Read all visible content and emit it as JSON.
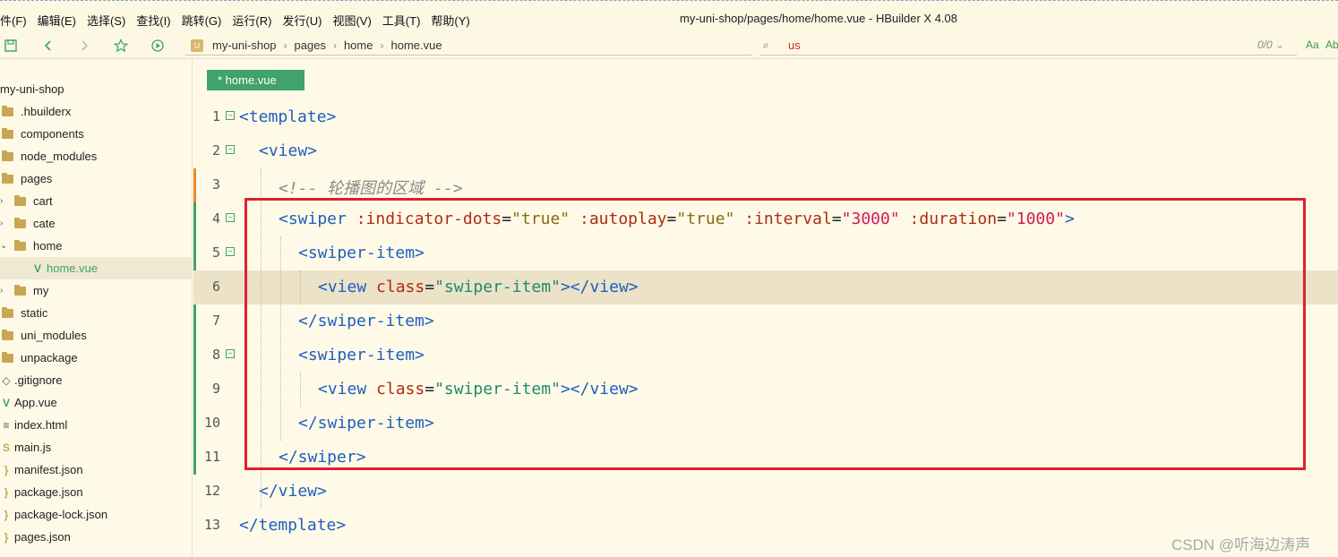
{
  "menubar": {
    "items": [
      "件(F)",
      "编辑(E)",
      "选择(S)",
      "查找(I)",
      "跳转(G)",
      "运行(R)",
      "发行(U)",
      "视图(V)",
      "工具(T)",
      "帮助(Y)"
    ],
    "window_title": "my-uni-shop/pages/home/home.vue - HBuilder X 4.08"
  },
  "toolbar": {
    "icons": [
      "save-icon",
      "back-icon",
      "forward-icon",
      "star-icon",
      "run-icon"
    ],
    "breadcrumb": [
      "my-uni-shop",
      "pages",
      "home",
      "home.vue"
    ],
    "search_text": "us",
    "search_count": "0/0",
    "case_label": "Aa",
    "word_label": "Ab"
  },
  "sidebar": {
    "items": [
      {
        "label": "my-uni-shop",
        "type": "root"
      },
      {
        "label": ".hbuilderx",
        "type": "folder"
      },
      {
        "label": "components",
        "type": "folder"
      },
      {
        "label": "node_modules",
        "type": "folder"
      },
      {
        "label": "pages",
        "type": "folder-open"
      },
      {
        "label": "cart",
        "type": "subfolder"
      },
      {
        "label": "cate",
        "type": "subfolder"
      },
      {
        "label": "home",
        "type": "subfolder-open"
      },
      {
        "label": "home.vue",
        "type": "vue-file"
      },
      {
        "label": "my",
        "type": "subfolder"
      },
      {
        "label": "static",
        "type": "folder"
      },
      {
        "label": "uni_modules",
        "type": "folder"
      },
      {
        "label": "unpackage",
        "type": "folder"
      },
      {
        "label": ".gitignore",
        "type": "file"
      },
      {
        "label": "App.vue",
        "type": "vue-file-root"
      },
      {
        "label": "index.html",
        "type": "html-file"
      },
      {
        "label": "main.js",
        "type": "js-file"
      },
      {
        "label": "manifest.json",
        "type": "json-file"
      },
      {
        "label": "package.json",
        "type": "json-file"
      },
      {
        "label": "package-lock.json",
        "type": "json-file"
      },
      {
        "label": "pages.json",
        "type": "json-file"
      }
    ]
  },
  "editor": {
    "tab_label": "* home.vue",
    "line_numbers": [
      "1",
      "2",
      "3",
      "4",
      "5",
      "6",
      "7",
      "8",
      "9",
      "10",
      "11",
      "12",
      "13"
    ],
    "lines": {
      "l1": {
        "open": "<template>"
      },
      "l2": {
        "open": "<view>"
      },
      "l3": {
        "comment": "<!-- 轮播图的区域 -->"
      },
      "l4": {
        "tag_open": "<swiper",
        "a1": ":indicator-dots",
        "v1": "\"true\"",
        "a2": ":autoplay",
        "v2": "\"true\"",
        "a3": ":interval",
        "v3": "\"3000\"",
        "a4": ":duration",
        "v4": "\"1000\"",
        "close": ">"
      },
      "l5": {
        "open": "<swiper-item>"
      },
      "l6": {
        "tag_open": "<view",
        "attr": "class",
        "val": "\"swiper-item\"",
        "tail": "></view>"
      },
      "l7": {
        "close": "</swiper-item>"
      },
      "l8": {
        "open": "<swiper-item>"
      },
      "l9": {
        "tag_open": "<view",
        "attr": "class",
        "val": "\"swiper-item\"",
        "tail": "></view>"
      },
      "l10": {
        "close": "</swiper-item>"
      },
      "l11": {
        "close": "</swiper>"
      },
      "l12": {
        "close": "</view>"
      },
      "l13": {
        "close": "</template>"
      }
    },
    "eq": "="
  },
  "watermark": "CSDN @听海边涛声",
  "colors": {
    "accent_green": "#3fa36a",
    "highlight_red": "#e02030",
    "background": "#fffae8"
  }
}
